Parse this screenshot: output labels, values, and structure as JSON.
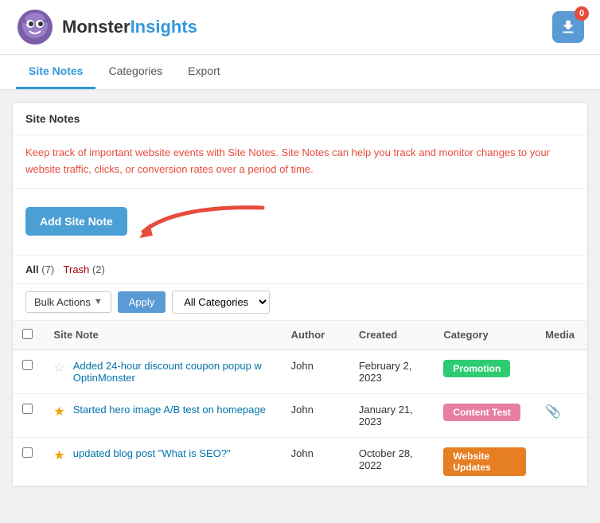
{
  "header": {
    "logo_text_black": "Monster",
    "logo_text_blue": "Insights",
    "notification_count": "0"
  },
  "tabs": [
    {
      "id": "site-notes",
      "label": "Site Notes",
      "active": true
    },
    {
      "id": "categories",
      "label": "Categories",
      "active": false
    },
    {
      "id": "export",
      "label": "Export",
      "active": false
    }
  ],
  "section": {
    "title": "Site Notes",
    "info_text": "Keep track of important website events with Site Notes. Site Notes can help you track and monitor changes to your website traffic, clicks, or conversion rates over a period of time.",
    "add_button_label": "Add Site Note"
  },
  "filters": {
    "all_label": "All",
    "all_count": "(7)",
    "trash_label": "Trash",
    "trash_count": "(2)"
  },
  "actions": {
    "bulk_actions_label": "Bulk Actions",
    "apply_label": "Apply",
    "all_categories_label": "All Categories"
  },
  "table": {
    "headers": {
      "site_note": "Site Note",
      "author": "Author",
      "created": "Created",
      "category": "Category",
      "media": "Media"
    },
    "rows": [
      {
        "id": "row-1",
        "star": "empty",
        "note": "Added 24-hour discount coupon popup w OptinMonster",
        "author": "John",
        "created": "February 2, 2023",
        "category": "Promotion",
        "category_style": "promotion",
        "media": ""
      },
      {
        "id": "row-2",
        "star": "filled",
        "note": "Started hero image A/B test on homepage",
        "author": "John",
        "created": "January 21, 2023",
        "category": "Content Test",
        "category_style": "content-test",
        "media": "paperclip"
      },
      {
        "id": "row-3",
        "star": "filled",
        "note": "updated blog post \"What is SEO?\"",
        "author": "John",
        "created": "October 28, 2022",
        "category": "Website Updates",
        "category_style": "website-updates",
        "media": ""
      }
    ]
  }
}
